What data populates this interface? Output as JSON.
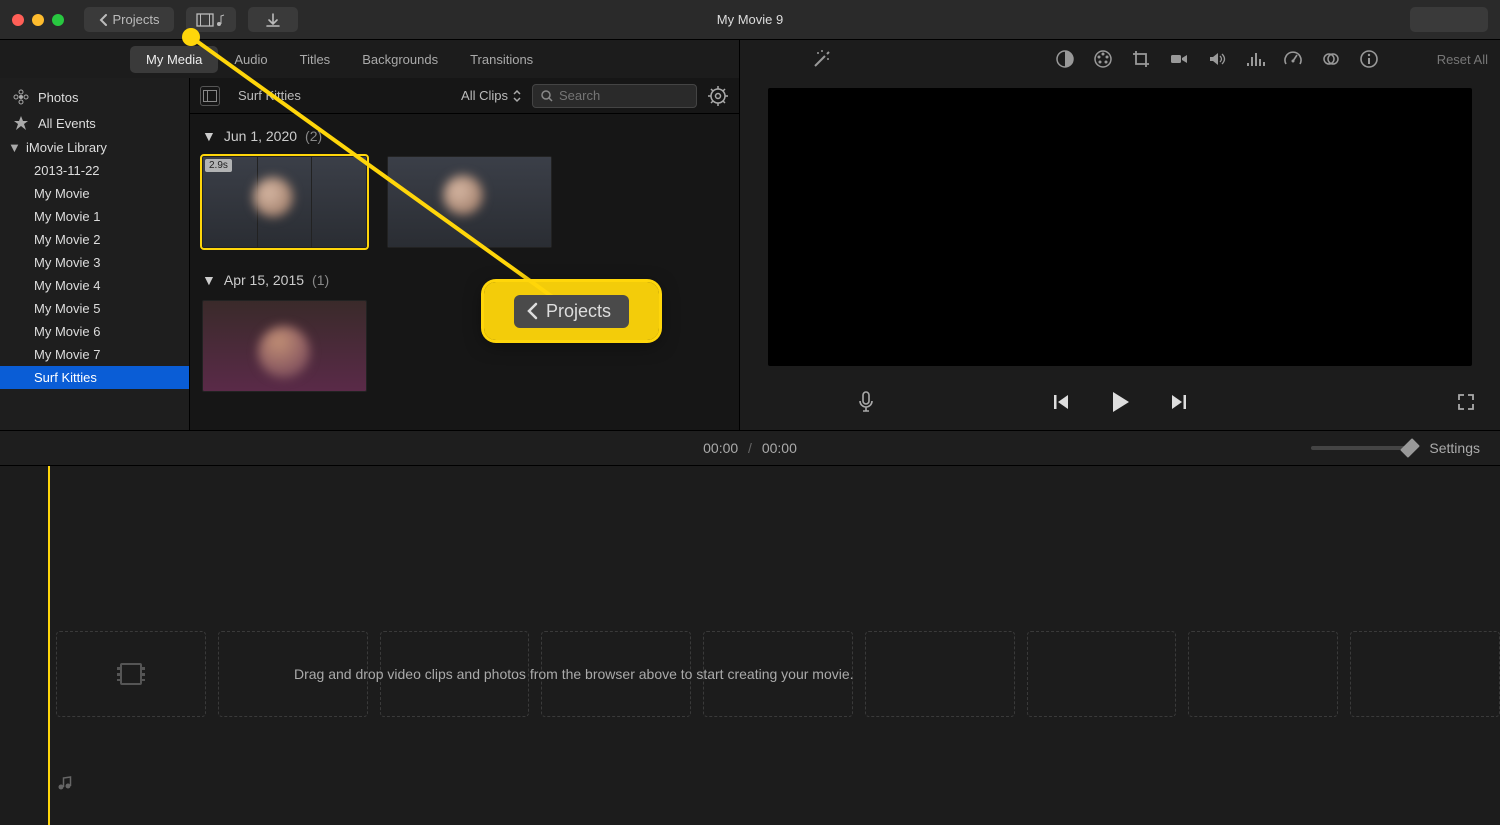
{
  "title": "My Movie 9",
  "toolbar": {
    "projects_label": "Projects"
  },
  "tabs": {
    "my_media": "My Media",
    "audio": "Audio",
    "titles": "Titles",
    "backgrounds": "Backgrounds",
    "transitions": "Transitions"
  },
  "sidebar": {
    "photos": "Photos",
    "all_events": "All Events",
    "library": "iMovie Library",
    "items": [
      "2013-11-22",
      "My Movie",
      "My Movie 1",
      "My Movie 2",
      "My Movie 3",
      "My Movie 4",
      "My Movie 5",
      "My Movie 6",
      "My Movie 7",
      "Surf Kitties"
    ]
  },
  "browser_header": {
    "current": "Surf Kitties",
    "filter": "All Clips",
    "search_placeholder": "Search"
  },
  "groups": [
    {
      "date": "Jun 1, 2020",
      "count": "(2)",
      "clips": [
        {
          "duration": "2.9s"
        },
        {}
      ]
    },
    {
      "date": "Apr 15, 2015",
      "count": "(1)",
      "clips": [
        {}
      ]
    }
  ],
  "viewer_tools": {
    "reset_all": "Reset All"
  },
  "timeline": {
    "time_current": "00:00",
    "time_sep": "/",
    "time_total": "00:00",
    "settings": "Settings",
    "placeholder_text": "Drag and drop video clips and photos from the browser above to start creating your movie."
  },
  "callout": {
    "label": "Projects"
  }
}
